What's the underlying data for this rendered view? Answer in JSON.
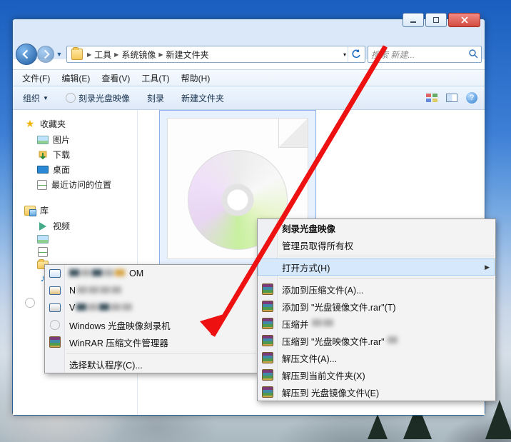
{
  "window_controls": {
    "minimize_tip": "Minimize",
    "maximize_tip": "Maximize",
    "close_tip": "Close"
  },
  "address": {
    "segments": [
      "工具",
      "系统镜像",
      "新建文件夹"
    ]
  },
  "search": {
    "placeholder": "搜索 新建..."
  },
  "menubar": {
    "file": "文件(F)",
    "edit": "编辑(E)",
    "view": "查看(V)",
    "tools": "工具(T)",
    "help": "帮助(H)"
  },
  "toolbar": {
    "organize": "组织",
    "burn_image": "刻录光盘映像",
    "burn": "刻录",
    "new_folder": "新建文件夹"
  },
  "sidebar": {
    "favorites": "收藏夹",
    "pictures": "图片",
    "downloads": "下载",
    "desktop": "桌面",
    "recent": "最近访问的位置",
    "libraries": "库",
    "videos": "视频"
  },
  "open_with_menu": {
    "censored_1_suffix": "OM",
    "censored_2_prefix": "N",
    "censored_3_prefix": "V",
    "windows_burner": "Windows 光盘映像刻录机",
    "winrar": "WinRAR 压缩文件管理器",
    "choose_default": "选择默认程序(C)..."
  },
  "context_menu": {
    "burn_disc_image": "刻录光盘映像",
    "admin_ownership": "管理员取得所有权",
    "open_with": "打开方式(H)",
    "add_to_archive": "添加到压缩文件(A)...",
    "add_to_named": "添加到 \"光盘镜像文件.rar\"(T)",
    "compress_and": "压缩并",
    "compress_to_named": "压缩到 \"光盘映像文件.rar\"",
    "extract_files": "解压文件(A)...",
    "extract_here": "解压到当前文件夹(X)",
    "extract_to_named": "解压到 光盘镜像文件\\(E)"
  }
}
